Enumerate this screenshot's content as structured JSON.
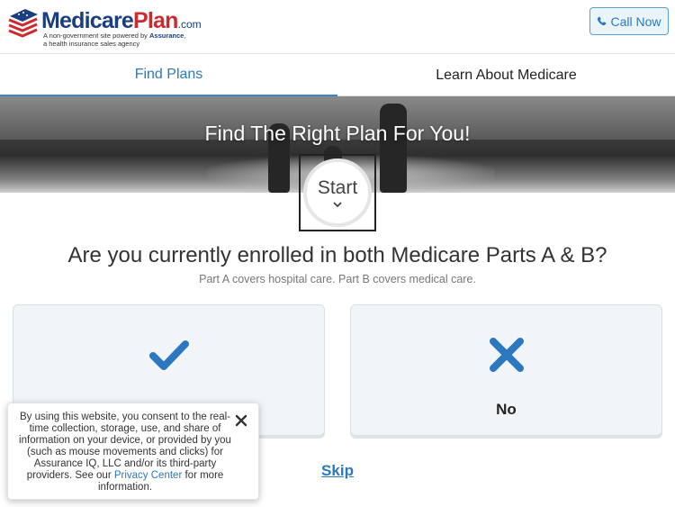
{
  "header": {
    "logo": {
      "word_primary": "Medicare",
      "word_secondary": "Plan",
      "word_suffix": ".com",
      "tagline_prefix": "A non-government site powered by ",
      "tagline_brand": "Assurance",
      "tagline_suffix": ",",
      "tagline_line2": "a health insurance sales agency"
    },
    "call_button": {
      "label": "Call Now",
      "icon": "phone-icon"
    }
  },
  "tabs": [
    {
      "label": "Find Plans",
      "active": true
    },
    {
      "label": "Learn About Medicare",
      "active": false
    }
  ],
  "hero": {
    "title": "Find The Right Plan For You!",
    "start_label": "Start",
    "start_icon": "chevron-down-icon"
  },
  "question": {
    "title": "Are you currently enrolled in both Medicare Parts A & B?",
    "subtitle": "Part A covers hospital care. Part B covers medical care."
  },
  "options": [
    {
      "label": "",
      "icon": "checkmark-icon"
    },
    {
      "label": "No",
      "icon": "x-mark-icon"
    }
  ],
  "skip_label": "Skip",
  "consent": {
    "text_before": "By using this website, you consent to the real-time collection, storage, use, and share of information on your device, or provided by you (such as mouse movements and clicks) for Assurance IQ, LLC and/or its third-party providers. See our ",
    "link_text": "Privacy Center",
    "text_after": " for more information.",
    "close_icon": "close-icon"
  },
  "colors": {
    "brand_blue": "#1a3e7e",
    "brand_red": "#cc2a2f",
    "accent_blue": "#2b78bf",
    "card_bg": "#f1f5f8"
  }
}
